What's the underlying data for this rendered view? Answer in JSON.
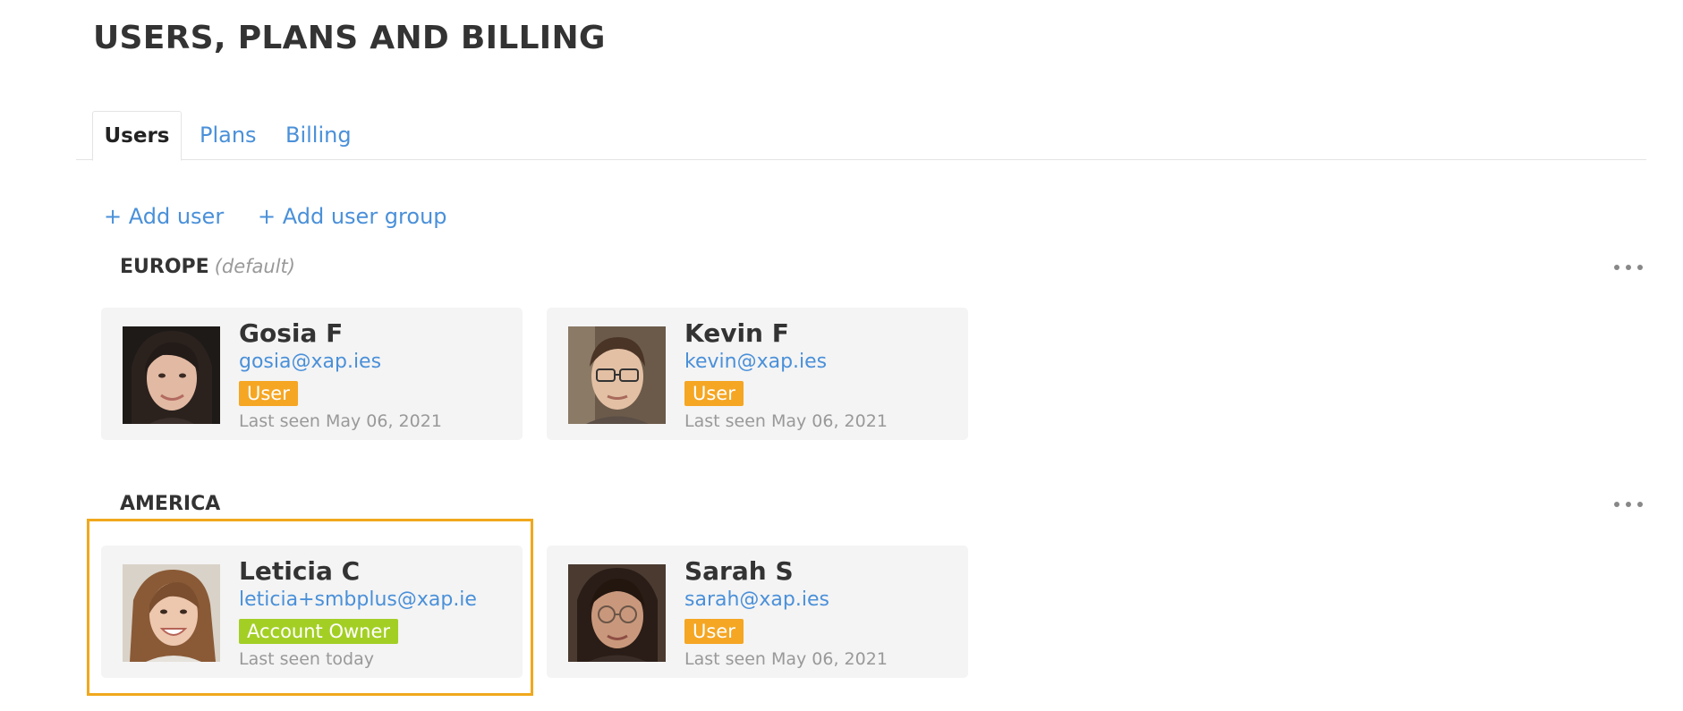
{
  "page": {
    "title": "USERS, PLANS AND BILLING"
  },
  "tabs": [
    {
      "label": "Users",
      "active": true
    },
    {
      "label": "Plans",
      "active": false
    },
    {
      "label": "Billing",
      "active": false
    }
  ],
  "actions": {
    "add_user": "+ Add user",
    "add_user_group": "+ Add user group"
  },
  "groups": [
    {
      "name": "EUROPE",
      "default_tag": "(default)",
      "users": [
        {
          "name": "Gosia F",
          "email": "gosia@xap.ies",
          "role": "User",
          "last_seen": "Last seen May 06, 2021"
        },
        {
          "name": "Kevin F",
          "email": "kevin@xap.ies",
          "role": "User",
          "last_seen": "Last seen May 06, 2021"
        }
      ]
    },
    {
      "name": "AMERICA",
      "users": [
        {
          "name": "Leticia C",
          "email": "leticia+smbplus@xap.ie",
          "role": "Account Owner",
          "last_seen": "Last seen today"
        },
        {
          "name": "Sarah S",
          "email": "sarah@xap.ies",
          "role": "User",
          "last_seen": "Last seen May 06, 2021"
        }
      ]
    }
  ],
  "colors": {
    "link": "#4a90d9",
    "role_user": "#f5a623",
    "role_owner": "#a3cf25",
    "highlight": "#f0a81c",
    "card_bg": "#f4f4f4"
  }
}
